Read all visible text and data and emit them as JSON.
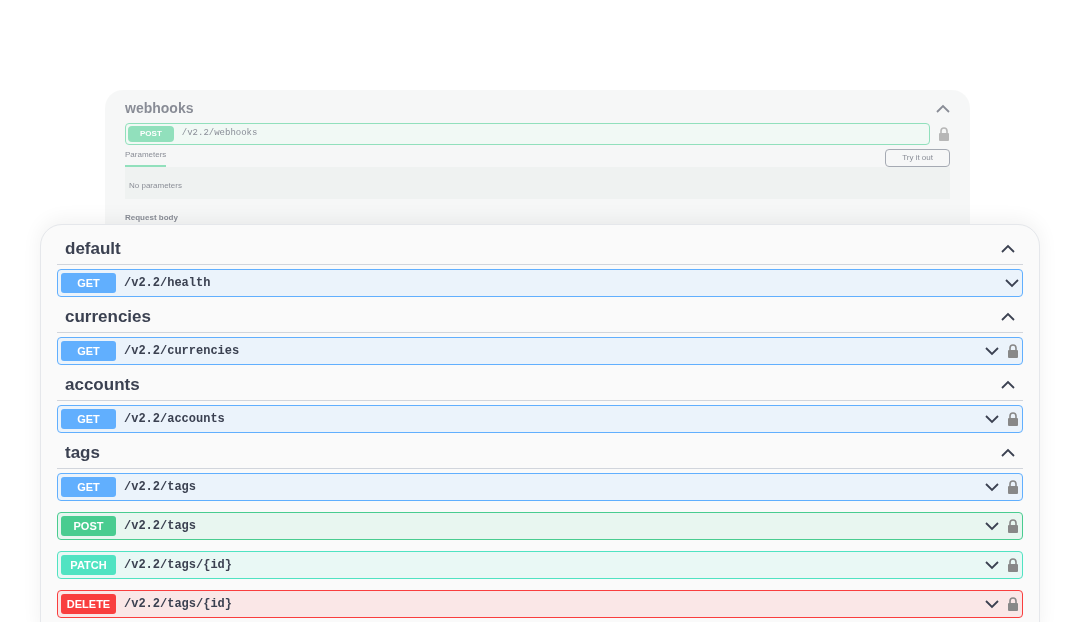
{
  "background_card": {
    "title": "webhooks",
    "operation": {
      "method": "POST",
      "path": "/v2.2/webhooks"
    },
    "tab": "Parameters",
    "try_button": "Try it out",
    "empty_text": "No parameters",
    "request_body_label": "Request body"
  },
  "sections": [
    {
      "name": "default",
      "expanded": true,
      "operations": [
        {
          "method": "GET",
          "path": "/v2.2/health",
          "locked": false
        }
      ]
    },
    {
      "name": "currencies",
      "expanded": true,
      "operations": [
        {
          "method": "GET",
          "path": "/v2.2/currencies",
          "locked": true
        }
      ]
    },
    {
      "name": "accounts",
      "expanded": true,
      "operations": [
        {
          "method": "GET",
          "path": "/v2.2/accounts",
          "locked": true
        }
      ]
    },
    {
      "name": "tags",
      "expanded": true,
      "operations": [
        {
          "method": "GET",
          "path": "/v2.2/tags",
          "locked": true
        },
        {
          "method": "POST",
          "path": "/v2.2/tags",
          "locked": true
        },
        {
          "method": "PATCH",
          "path": "/v2.2/tags/{id}",
          "locked": true
        },
        {
          "method": "DELETE",
          "path": "/v2.2/tags/{id}",
          "locked": true
        }
      ]
    }
  ]
}
